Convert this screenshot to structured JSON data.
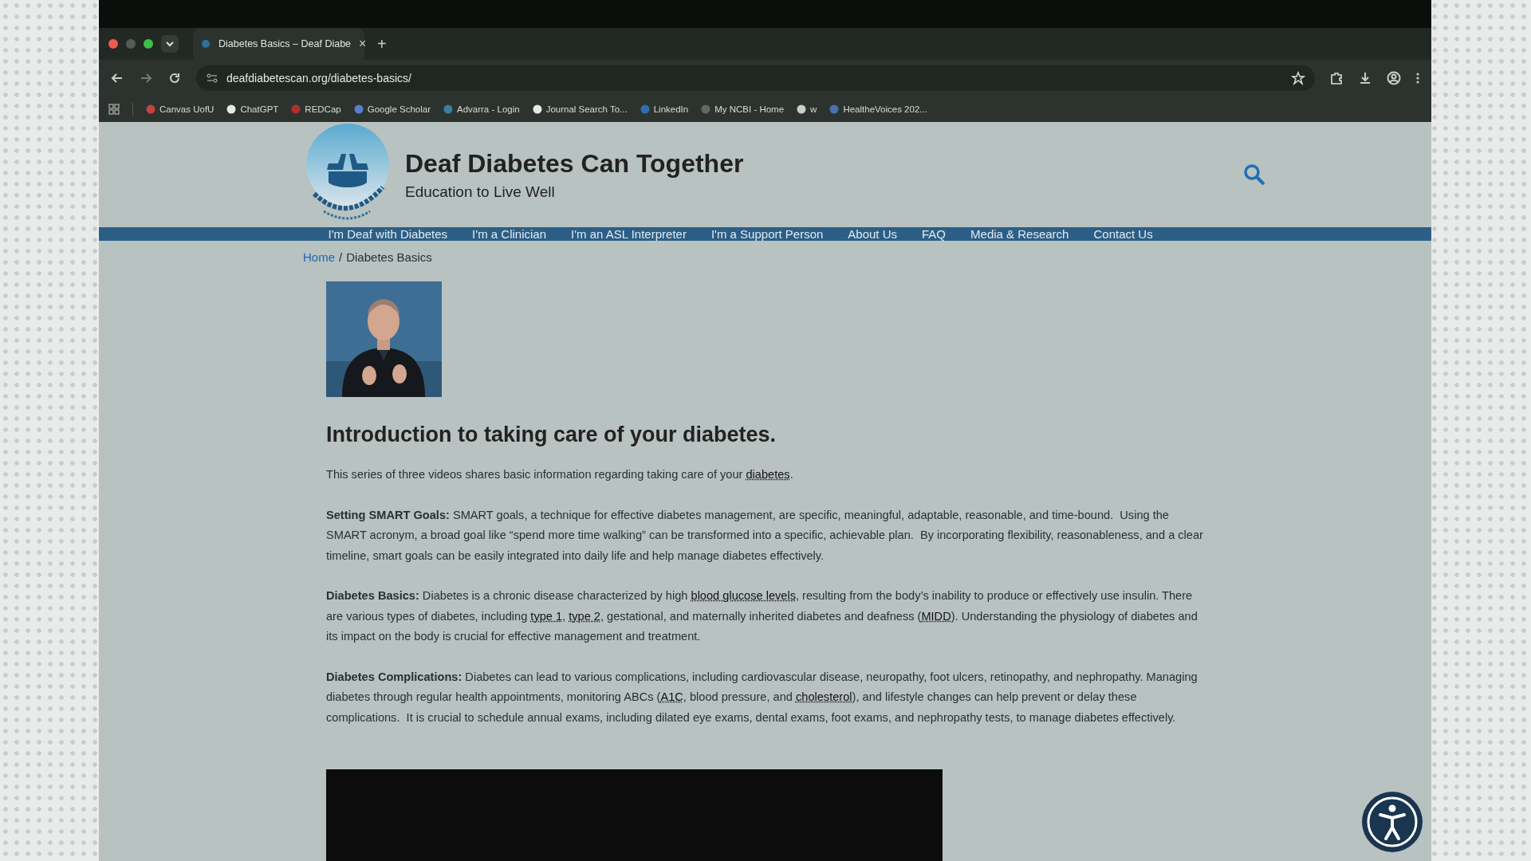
{
  "browser": {
    "tab": {
      "title": "Diabetes Basics – Deaf Diabe",
      "close": "×"
    },
    "new_tab": "+",
    "address": "deafdiabetescan.org/diabetes-basics/",
    "bookmarks": [
      {
        "label": "Canvas UofU"
      },
      {
        "label": "ChatGPT"
      },
      {
        "label": "REDCap"
      },
      {
        "label": "Google Scholar"
      },
      {
        "label": "Advarra - Login"
      },
      {
        "label": "Journal Search To..."
      },
      {
        "label": "LinkedIn"
      },
      {
        "label": "My NCBI - Home"
      },
      {
        "label": "w"
      },
      {
        "label": "HealtheVoices 202..."
      }
    ]
  },
  "site": {
    "title": "Deaf Diabetes Can Together",
    "tagline": "Education to Live Well"
  },
  "nav": [
    {
      "label": "I'm Deaf with Diabetes"
    },
    {
      "label": "I'm a Clinician"
    },
    {
      "label": "I'm an ASL Interpreter"
    },
    {
      "label": "I'm a Support Person"
    },
    {
      "label": "About Us"
    },
    {
      "label": "FAQ"
    },
    {
      "label": "Media & Research"
    },
    {
      "label": "Contact Us"
    }
  ],
  "breadcrumb": {
    "link": "Home",
    "separator": "/",
    "current": "Diabetes Basics"
  },
  "content": {
    "heading": "Introduction to taking care of your diabetes.",
    "paragraphs": [
      {
        "segments": [
          {
            "kind": "plain",
            "text": "This series of three videos shares basic information regarding taking care of your "
          },
          {
            "kind": "link",
            "text": "diabetes"
          },
          {
            "kind": "plain",
            "text": "."
          }
        ]
      },
      {
        "segments": [
          {
            "kind": "bold",
            "text": "Setting SMART Goals:"
          },
          {
            "kind": "plain",
            "text": " SMART goals, a technique for effective diabetes management, are specific, meaningful, adaptable, reasonable, and time-bound.  Using the SMART acronym, a broad goal like “spend more time walking” can be transformed into a specific, achievable plan.  By incorporating flexibility, reasonableness, and a clear timeline, smart goals can be easily integrated into daily life and help manage diabetes effectively."
          }
        ]
      },
      {
        "segments": [
          {
            "kind": "bold",
            "text": "Diabetes Basics:"
          },
          {
            "kind": "plain",
            "text": " Diabetes is a chronic disease characterized by high "
          },
          {
            "kind": "link",
            "text": "blood glucose levels"
          },
          {
            "kind": "plain",
            "text": ", resulting from the body’s inability to produce or effectively use insulin. There are various types of diabetes, including "
          },
          {
            "kind": "link",
            "text": "type 1"
          },
          {
            "kind": "plain",
            "text": ", "
          },
          {
            "kind": "link",
            "text": "type 2"
          },
          {
            "kind": "plain",
            "text": ", gestational, and maternally inherited diabetes and deafness ("
          },
          {
            "kind": "link",
            "text": "MIDD"
          },
          {
            "kind": "plain",
            "text": "). Understanding the physiology of diabetes and its impact on the body is crucial for effective management and treatment."
          }
        ]
      },
      {
        "segments": [
          {
            "kind": "bold",
            "text": "Diabetes Complications:"
          },
          {
            "kind": "plain",
            "text": " Diabetes can lead to various complications, including cardiovascular disease, neuropathy, foot ulcers, retinopathy, and nephropathy. Managing diabetes through regular health appointments, monitoring ABCs ("
          },
          {
            "kind": "link",
            "text": "A1C"
          },
          {
            "kind": "plain",
            "text": ", blood pressure, and "
          },
          {
            "kind": "link",
            "text": "cholesterol"
          },
          {
            "kind": "plain",
            "text": "), and lifestyle changes can help prevent or delay these complications.  It is crucial to schedule annual exams, including dilated eye exams, dental exams, foot exams, and nephropathy tests, to manage diabetes effectively."
          }
        ]
      }
    ]
  }
}
